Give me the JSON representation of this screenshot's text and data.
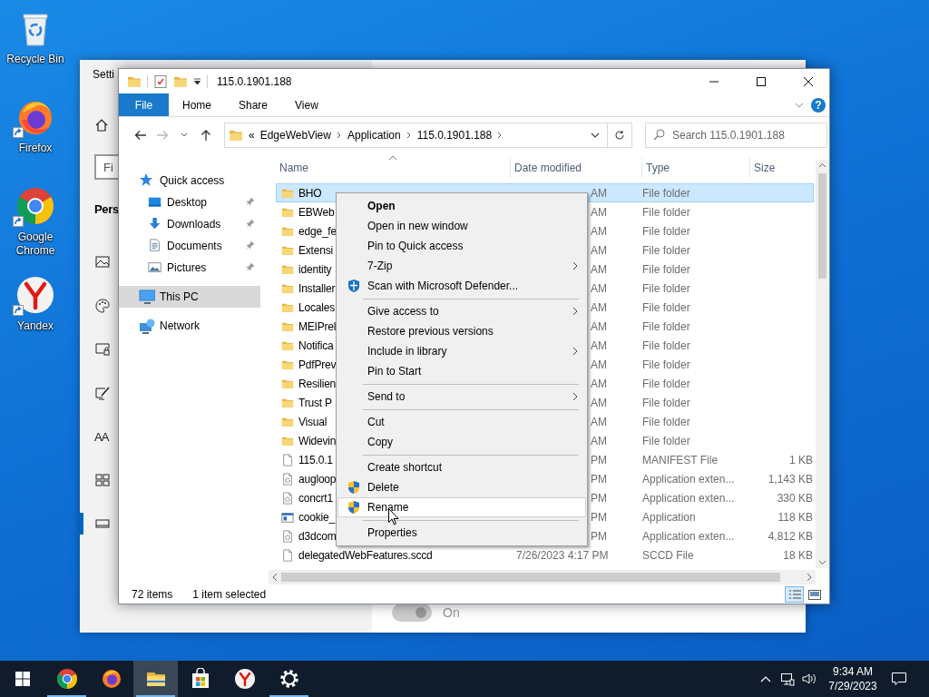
{
  "desktop_icons": [
    {
      "label": "Recycle Bin",
      "shortcut": false
    },
    {
      "label": "Firefox",
      "shortcut": true
    },
    {
      "label": "Google Chrome",
      "shortcut": true
    },
    {
      "label": "Yandex",
      "shortcut": true
    }
  ],
  "settings_window": {
    "title": "Setti",
    "search": {
      "placeholder": "Fi"
    },
    "heading": "Pers",
    "nav": [
      {
        "selected": false
      },
      {
        "selected": false
      },
      {
        "selected": false
      },
      {
        "selected": false
      },
      {
        "selected": false,
        "glyph": "AA"
      },
      {
        "selected": false
      },
      {
        "selected": true
      }
    ],
    "toggle": {
      "label": "On",
      "on": true,
      "disabled": true
    }
  },
  "explorer": {
    "title": "115.0.1901.188",
    "ribbon_tabs": [
      {
        "label": "File",
        "kind": "menu"
      },
      {
        "label": "Home",
        "kind": "tab"
      },
      {
        "label": "Share",
        "kind": "tab"
      },
      {
        "label": "View",
        "kind": "tab"
      }
    ],
    "help": "?",
    "address": {
      "overflow": "«",
      "segments": [
        "EdgeWebView",
        "Application",
        "115.0.1901.188"
      ]
    },
    "search": {
      "placeholder": "Search 115.0.1901.188"
    },
    "nav_pane": [
      {
        "label": "Quick access",
        "kind": "star",
        "selected": false,
        "children": [
          {
            "label": "Desktop",
            "kind": "desktop",
            "selected": false,
            "pinned": true
          },
          {
            "label": "Downloads",
            "kind": "downloads",
            "selected": false,
            "pinned": true
          },
          {
            "label": "Documents",
            "kind": "documents",
            "selected": false,
            "pinned": true
          },
          {
            "label": "Pictures",
            "kind": "pictures",
            "selected": false,
            "pinned": true
          }
        ]
      },
      {
        "label": "This PC",
        "kind": "pc",
        "selected": true
      },
      {
        "label": "Network",
        "kind": "network",
        "selected": false
      }
    ],
    "columns": [
      "Name",
      "Date modified",
      "Type",
      "Size"
    ],
    "rows": [
      {
        "name": "BHO",
        "date": "AM",
        "type": "File folder",
        "kind": "folder",
        "selected": true
      },
      {
        "name": "EBWeb",
        "date": "AM",
        "type": "File folder",
        "kind": "folder",
        "selected": false
      },
      {
        "name": "edge_fe",
        "date": "AM",
        "type": "File folder",
        "kind": "folder",
        "selected": false
      },
      {
        "name": "Extensi",
        "date": "AM",
        "type": "File folder",
        "kind": "folder",
        "selected": false
      },
      {
        "name": "identity",
        "date": "AM",
        "type": "File folder",
        "kind": "folder",
        "selected": false
      },
      {
        "name": "Installer",
        "date": "AM",
        "type": "File folder",
        "kind": "folder",
        "selected": false
      },
      {
        "name": "Locales",
        "date": "AM",
        "type": "File folder",
        "kind": "folder",
        "selected": false
      },
      {
        "name": "MEIPrel",
        "date": "AM",
        "type": "File folder",
        "kind": "folder",
        "selected": false
      },
      {
        "name": "Notifica",
        "date": "AM",
        "type": "File folder",
        "kind": "folder",
        "selected": false
      },
      {
        "name": "PdfPrev",
        "date": "AM",
        "type": "File folder",
        "kind": "folder",
        "selected": false
      },
      {
        "name": "Resilien",
        "date": "AM",
        "type": "File folder",
        "kind": "folder",
        "selected": false
      },
      {
        "name": "Trust P",
        "date": "AM",
        "type": "File folder",
        "kind": "folder",
        "selected": false
      },
      {
        "name": "Visual",
        "date": "AM",
        "type": "File folder",
        "kind": "folder",
        "selected": false
      },
      {
        "name": "Widevin",
        "date": "AM",
        "type": "File folder",
        "kind": "folder",
        "selected": false
      },
      {
        "name": "115.0.1",
        "date": "PM",
        "type": "MANIFEST File",
        "size": "1 KB",
        "kind": "file",
        "selected": false
      },
      {
        "name": "augloop",
        "date": "PM",
        "type": "Application exten...",
        "size": "1,143 KB",
        "kind": "library",
        "selected": false
      },
      {
        "name": "concrt1",
        "date": "PM",
        "type": "Application exten...",
        "size": "330 KB",
        "kind": "library",
        "selected": false
      },
      {
        "name": "cookie_",
        "date": "PM",
        "type": "Application",
        "size": "118 KB",
        "kind": "app",
        "selected": false
      },
      {
        "name": "d3dcom",
        "date": "PM",
        "type": "Application exten...",
        "size": "4,812 KB",
        "kind": "library",
        "selected": false
      },
      {
        "name": "delegatedWebFeatures.sccd",
        "date": "7/26/2023 4:17 PM",
        "type": "SCCD File",
        "size": "18 KB",
        "kind": "file",
        "selected": false
      }
    ],
    "status": {
      "count": "72 items",
      "selection": "1 item selected"
    },
    "view_buttons": [
      {
        "selected": true
      },
      {
        "selected": false
      }
    ]
  },
  "context_menu": [
    {
      "kind": "item",
      "label": "Open",
      "default": true,
      "submenu": false,
      "highlighted": false
    },
    {
      "kind": "item",
      "label": "Open in new window",
      "default": false,
      "submenu": false,
      "highlighted": false
    },
    {
      "kind": "item",
      "label": "Pin to Quick access",
      "default": false,
      "submenu": false,
      "highlighted": false
    },
    {
      "kind": "item",
      "label": "7-Zip",
      "default": false,
      "submenu": true,
      "highlighted": false
    },
    {
      "kind": "scan",
      "label": "Scan with Microsoft Defender...",
      "default": false,
      "submenu": false,
      "highlighted": false
    },
    {
      "kind": "separator"
    },
    {
      "kind": "item",
      "label": "Give access to",
      "default": false,
      "submenu": true,
      "highlighted": false
    },
    {
      "kind": "item",
      "label": "Restore previous versions",
      "default": false,
      "submenu": false,
      "highlighted": false
    },
    {
      "kind": "item",
      "label": "Include in library",
      "default": false,
      "submenu": true,
      "highlighted": false
    },
    {
      "kind": "item",
      "label": "Pin to Start",
      "default": false,
      "submenu": false,
      "highlighted": false
    },
    {
      "kind": "separator"
    },
    {
      "kind": "item",
      "label": "Send to",
      "default": false,
      "submenu": true,
      "highlighted": false
    },
    {
      "kind": "separator"
    },
    {
      "kind": "item",
      "label": "Cut",
      "default": false,
      "submenu": false,
      "highlighted": false
    },
    {
      "kind": "item",
      "label": "Copy",
      "default": false,
      "submenu": false,
      "highlighted": false
    },
    {
      "kind": "separator"
    },
    {
      "kind": "item",
      "label": "Create shortcut",
      "default": false,
      "submenu": false,
      "highlighted": false
    },
    {
      "kind": "admin",
      "label": "Delete",
      "default": false,
      "submenu": false,
      "highlighted": false
    },
    {
      "kind": "admin",
      "label": "Rename",
      "default": false,
      "submenu": false,
      "highlighted": true
    },
    {
      "kind": "separator"
    },
    {
      "kind": "item",
      "label": "Properties",
      "default": false,
      "submenu": false,
      "highlighted": false
    }
  ],
  "taskbar": {
    "apps": [
      {
        "running": true,
        "active": false
      },
      {
        "running": false,
        "active": false
      },
      {
        "running": true,
        "active": true
      },
      {
        "running": false,
        "active": false
      },
      {
        "running": false,
        "active": false
      },
      {
        "running": true,
        "active": false
      }
    ],
    "tray": {
      "time": "9:34 AM",
      "date": "7/29/2023"
    }
  }
}
